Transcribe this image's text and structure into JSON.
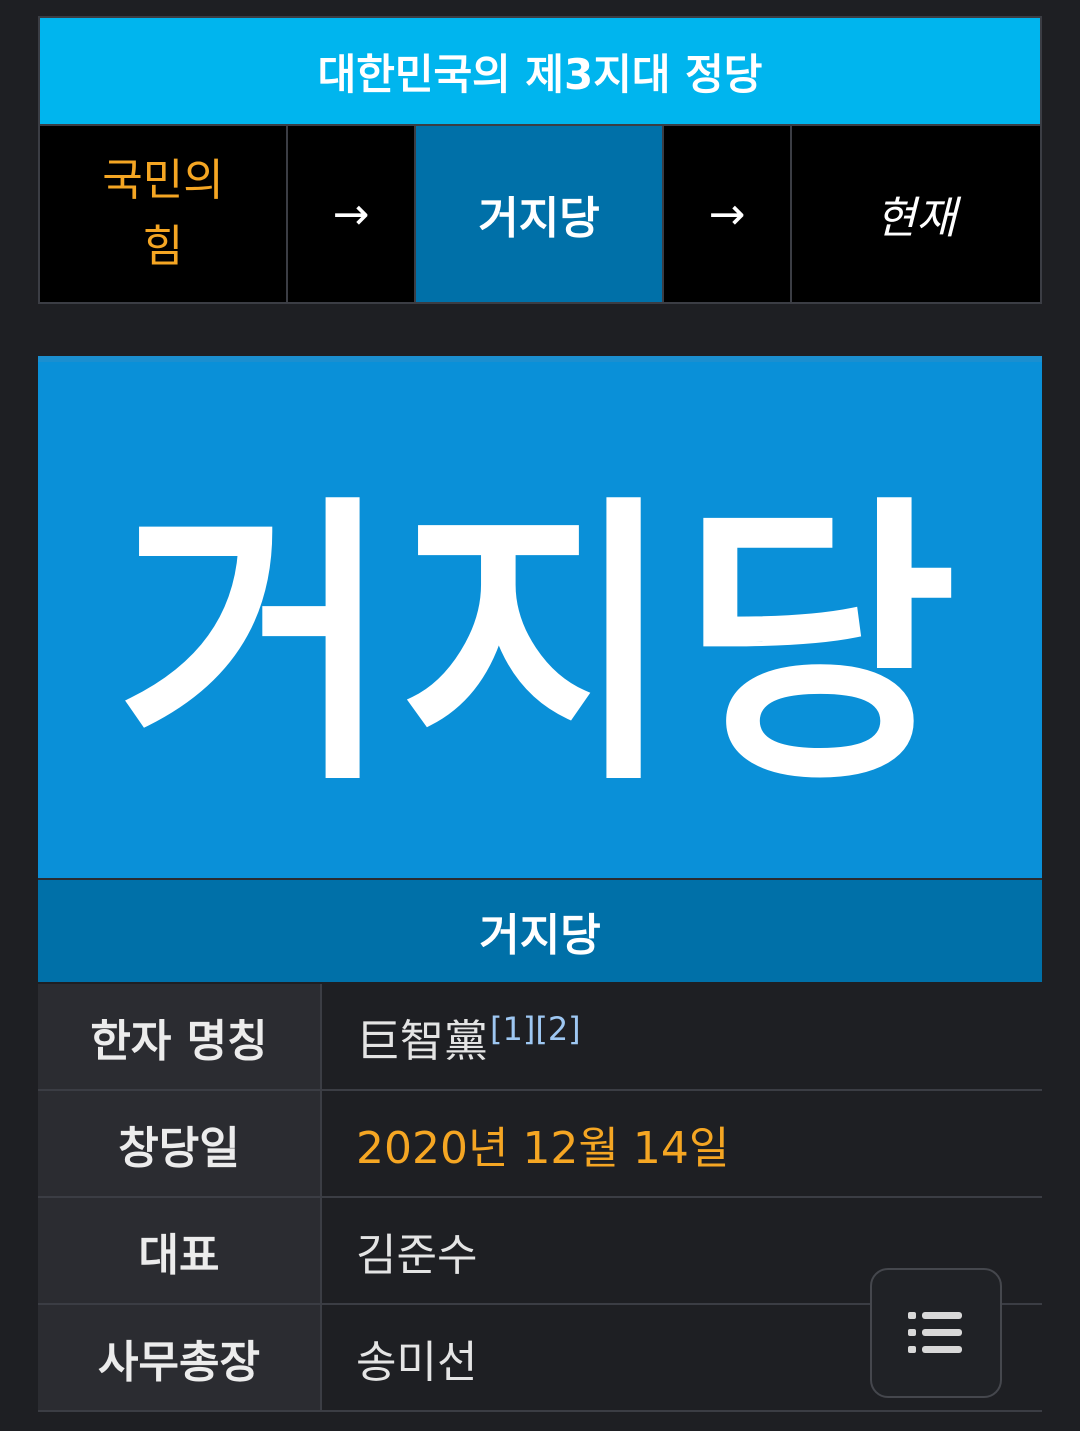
{
  "nav": {
    "title": "대한민국의 제3지대 정당",
    "prev": "국민의\n힘",
    "arrow1": "→",
    "current": "거지당",
    "arrow2": "→",
    "next": "현재"
  },
  "logo": {
    "text": "거지당"
  },
  "party_name": "거지당",
  "info": {
    "rows": [
      {
        "label": "한자 명칭",
        "value": "巨智黨",
        "refs": "[1][2]"
      },
      {
        "label": "창당일",
        "value": "2020년 12월 14일"
      },
      {
        "label": "대표",
        "value": "김준수"
      },
      {
        "label": "사무총장",
        "value": "송미선"
      }
    ]
  },
  "colors": {
    "header_cyan": "#00b5ee",
    "current_blue": "#0070a8",
    "logo_blue": "#0a90d8",
    "accent_orange": "#f5a623",
    "background": "#1e1f23"
  },
  "icons": {
    "toc": "list-icon"
  }
}
